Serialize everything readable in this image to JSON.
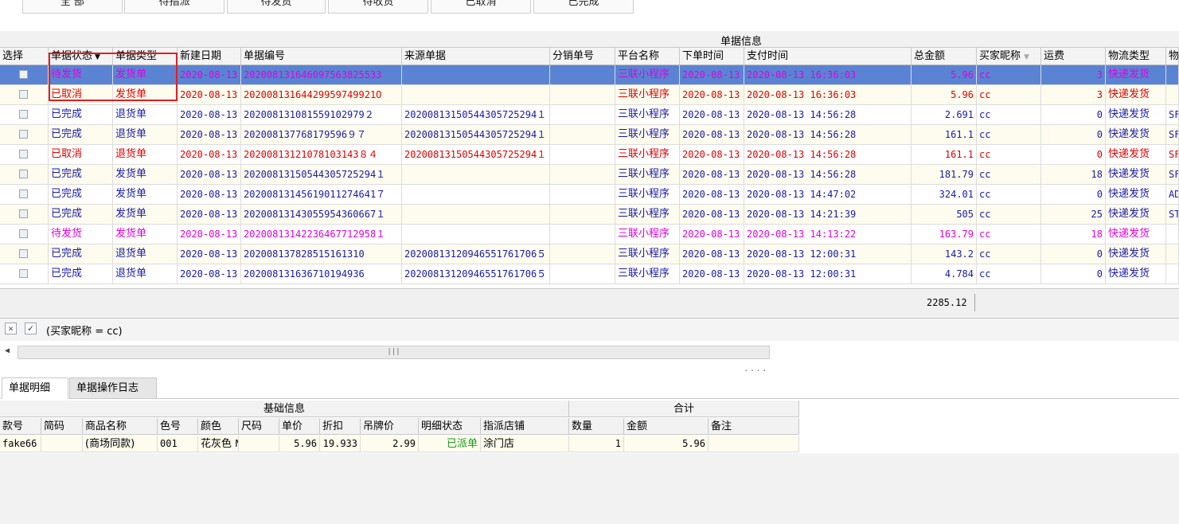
{
  "top_tabs": [
    "全 部",
    "待指派",
    "待发货",
    "待收货",
    "已取消",
    "已完成"
  ],
  "grid": {
    "group_title": "单据信息",
    "columns": [
      "选择",
      "单据状态",
      "单据类型",
      "新建日期",
      "单据编号",
      "来源单据",
      "分销单号",
      "平台名称",
      "下单时间",
      "支付时间",
      "总金额",
      "买家昵称",
      "运费",
      "物流类型",
      "物"
    ],
    "rows": [
      {
        "status": "待发货",
        "type": "发货单",
        "date": "2020-08-13",
        "no": "20200813164609756382553З",
        "source": "",
        "dist": "",
        "platform": "三联小程序",
        "order_time": "2020-08-13",
        "pay_time": "2020-08-13 16:36:03",
        "amount": "5.96",
        "buyer": "cc",
        "freight": "3",
        "logistics": "快递发货",
        "extra": "",
        "color": "pink",
        "selected": true
      },
      {
        "status": "已取消",
        "type": "发货单",
        "date": "2020-08-13",
        "no": "20200813164429959749921O",
        "source": "",
        "dist": "",
        "platform": "三联小程序",
        "order_time": "2020-08-13",
        "pay_time": "2020-08-13 16:36:03",
        "amount": "5.96",
        "buyer": "cc",
        "freight": "3",
        "logistics": "快递发货",
        "extra": "",
        "color": "red",
        "selected": false
      },
      {
        "status": "已完成",
        "type": "退货单",
        "date": "2020-08-13",
        "no": "202008131081559102979２",
        "source": "20200813150544305725294１",
        "dist": "",
        "platform": "三联小程序",
        "order_time": "2020-08-13",
        "pay_time": "2020-08-13 14:56:28",
        "amount": "2.691",
        "buyer": "cc",
        "freight": "0",
        "logistics": "快递发货",
        "extra": "SF",
        "color": "blue",
        "selected": false
      },
      {
        "status": "已完成",
        "type": "退货单",
        "date": "2020-08-13",
        "no": "202008137768179596９７",
        "source": "20200813150544305725294１",
        "dist": "",
        "platform": "三联小程序",
        "order_time": "2020-08-13",
        "pay_time": "2020-08-13 14:56:28",
        "amount": "161.1",
        "buyer": "cc",
        "freight": "0",
        "logistics": "快递发货",
        "extra": "SF",
        "color": "blue",
        "selected": false
      },
      {
        "status": "已取消",
        "type": "退货单",
        "date": "2020-08-13",
        "no": "20200813121078103143８４",
        "source": "20200813150544305725294１",
        "dist": "",
        "platform": "三联小程序",
        "order_time": "2020-08-13",
        "pay_time": "2020-08-13 14:56:28",
        "amount": "161.1",
        "buyer": "cc",
        "freight": "0",
        "logistics": "快递发货",
        "extra": "SF",
        "color": "red",
        "selected": false
      },
      {
        "status": "已完成",
        "type": "发货单",
        "date": "2020-08-13",
        "no": "20200813150544305725294１",
        "source": "",
        "dist": "",
        "platform": "三联小程序",
        "order_time": "2020-08-13",
        "pay_time": "2020-08-13 14:56:28",
        "amount": "181.79",
        "buyer": "cc",
        "freight": "18",
        "logistics": "快递发货",
        "extra": "SF",
        "color": "blue",
        "selected": false
      },
      {
        "status": "已完成",
        "type": "发货单",
        "date": "2020-08-13",
        "no": "20200813145619011274641７",
        "source": "",
        "dist": "",
        "platform": "三联小程序",
        "order_time": "2020-08-13",
        "pay_time": "2020-08-13 14:47:02",
        "amount": "324.01",
        "buyer": "cc",
        "freight": "0",
        "logistics": "快递发货",
        "extra": "AD",
        "color": "blue",
        "selected": false
      },
      {
        "status": "已完成",
        "type": "发货单",
        "date": "2020-08-13",
        "no": "20200813143055954360667１",
        "source": "",
        "dist": "",
        "platform": "三联小程序",
        "order_time": "2020-08-13",
        "pay_time": "2020-08-13 14:21:39",
        "amount": "505",
        "buyer": "cc",
        "freight": "25",
        "logistics": "快递发货",
        "extra": "ST",
        "color": "blue",
        "selected": false
      },
      {
        "status": "待发货",
        "type": "发货单",
        "date": "2020-08-13",
        "no": "20200813142236467712958１",
        "source": "",
        "dist": "",
        "platform": "三联小程序",
        "order_time": "2020-08-13",
        "pay_time": "2020-08-13 14:13:22",
        "amount": "163.79",
        "buyer": "cc",
        "freight": "18",
        "logistics": "快递发货",
        "extra": "",
        "color": "pink",
        "selected": false
      },
      {
        "status": "已完成",
        "type": "退货单",
        "date": "2020-08-13",
        "no": "202008137828515161310",
        "source": "20200813120946551761706５",
        "dist": "",
        "platform": "三联小程序",
        "order_time": "2020-08-13",
        "pay_time": "2020-08-13 12:00:31",
        "amount": "143.2",
        "buyer": "cc",
        "freight": "0",
        "logistics": "快递发货",
        "extra": "",
        "color": "blue",
        "selected": false
      },
      {
        "status": "已完成",
        "type": "退货单",
        "date": "2020-08-13",
        "no": "202008131636710194936",
        "source": "20200813120946551761706５",
        "dist": "",
        "platform": "三联小程序",
        "order_time": "2020-08-13",
        "pay_time": "2020-08-13 12:00:31",
        "amount": "4.784",
        "buyer": "cc",
        "freight": "0",
        "logistics": "快递发货",
        "extra": "",
        "color": "blue",
        "selected": false
      }
    ],
    "total": "2285.12"
  },
  "filter": {
    "text": "(买家昵称 = cc)",
    "clear_icon": "close-icon",
    "checked": true
  },
  "bottom_tabs": [
    "单据明细",
    "单据操作日志"
  ],
  "detail": {
    "group1": "基础信息",
    "group2": "合计",
    "columns": [
      "款号",
      "简码",
      "商品名称",
      "色号",
      "颜色",
      "尺码",
      "单价",
      "折扣",
      "吊牌价",
      "明细状态",
      "指派店铺",
      "数量",
      "金额",
      "备注"
    ],
    "row": {
      "code": "fake66",
      "short": "",
      "name": "(商场同款)",
      "color_no": "001",
      "color": "花灰色",
      "size": "M",
      "price": "5.96",
      "discount": "19.933",
      "tag_price": "2.99",
      "status": "已派单",
      "store": "涂门店",
      "qty": "1",
      "amount": "5.96",
      "note": ""
    }
  },
  "colors": {
    "selected_row": "#5b83d3",
    "blue": "#1a1aa8",
    "red": "#e00000",
    "pink": "#e000e0",
    "assigned_green": "#1a9a1a"
  }
}
